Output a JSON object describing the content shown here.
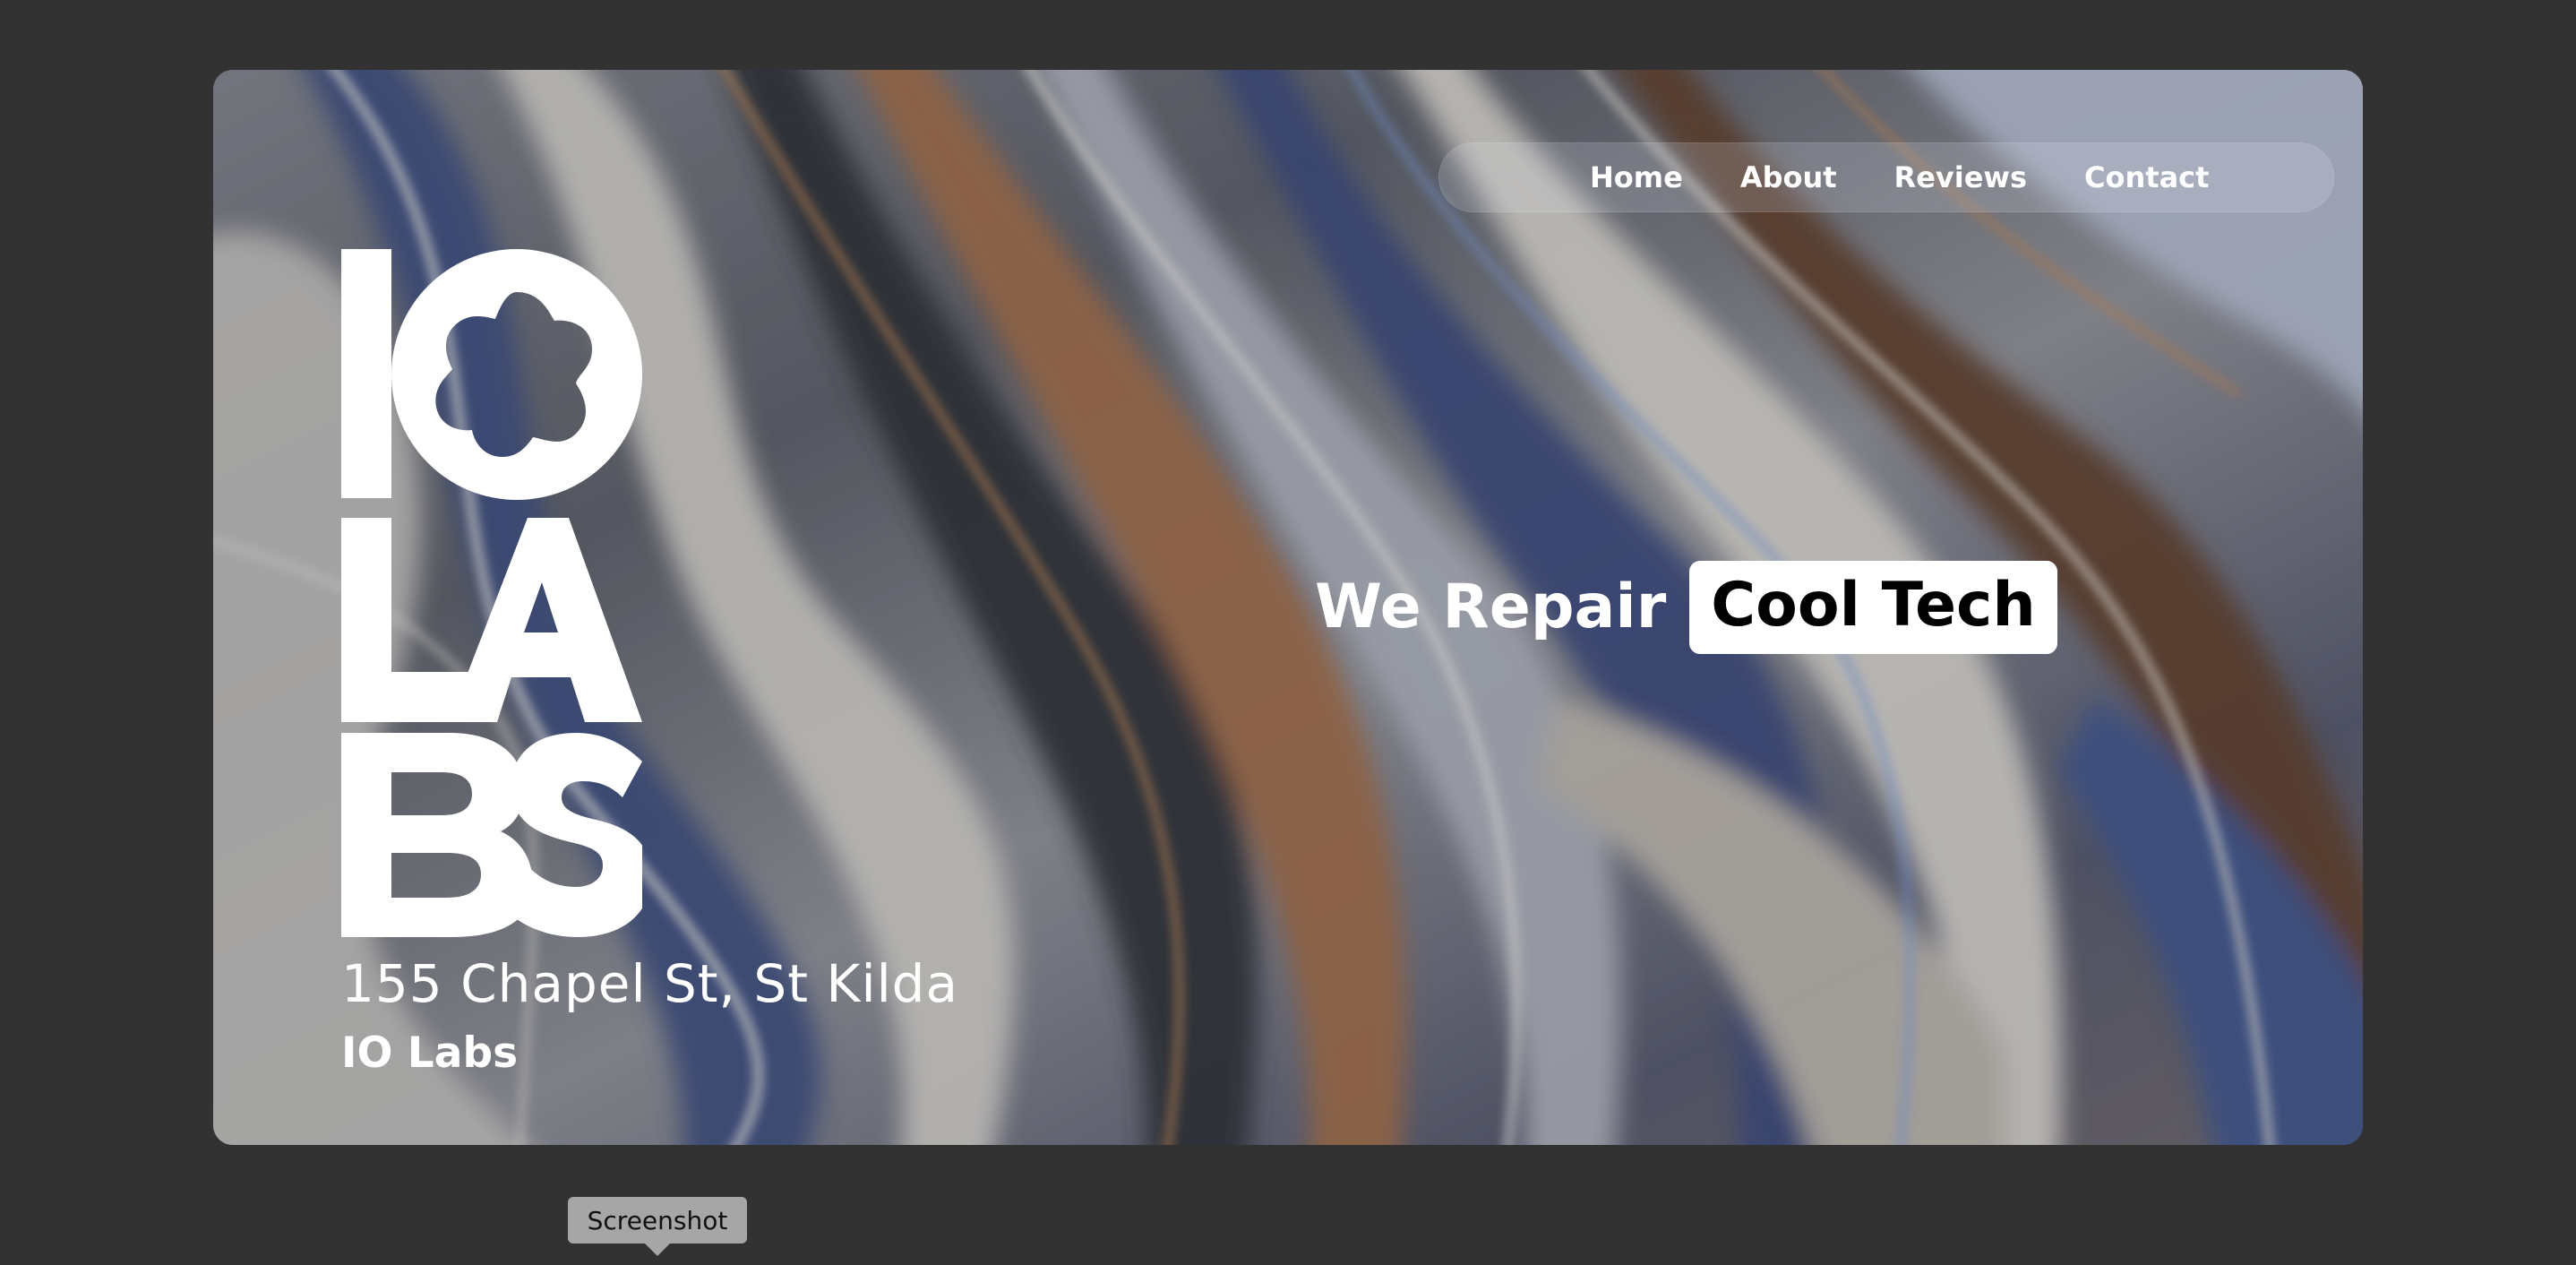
{
  "nav": {
    "items": [
      {
        "label": "Home"
      },
      {
        "label": "About"
      },
      {
        "label": "Reviews"
      },
      {
        "label": "Contact"
      }
    ]
  },
  "hero": {
    "logo_text": "IO LABS",
    "address": "155 Chapel St, St Kilda",
    "brand_name": "IO Labs",
    "tagline_lead": "We Repair",
    "tagline_highlight": "Cool Tech"
  },
  "tooltip": {
    "label": "Screenshot"
  },
  "colors": {
    "page_background": "#323232",
    "text_on_hero": "#ffffff",
    "badge_background": "#ffffff",
    "badge_text": "#000000",
    "tooltip_background": "#a6a6a6"
  },
  "icons": {
    "logo": "io-labs-logo"
  }
}
